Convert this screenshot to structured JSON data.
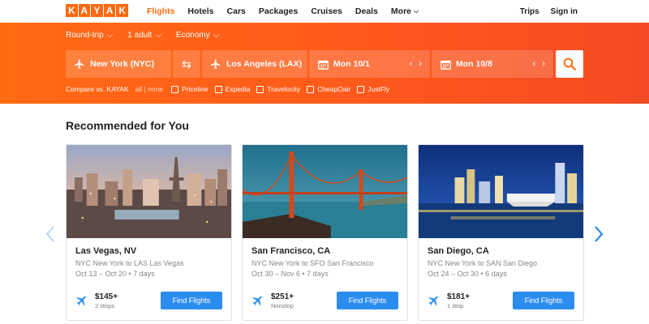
{
  "brand": {
    "logo_letters": [
      "K",
      "A",
      "Y",
      "A",
      "K"
    ],
    "accent": "#ff690f"
  },
  "nav": {
    "items": [
      {
        "label": "Flights",
        "active": true
      },
      {
        "label": "Hotels"
      },
      {
        "label": "Cars"
      },
      {
        "label": "Packages"
      },
      {
        "label": "Cruises"
      },
      {
        "label": "Deals"
      },
      {
        "label": "More"
      }
    ],
    "right": {
      "trips": "Trips",
      "signin": "Sign in"
    }
  },
  "search": {
    "trip_type": "Round-trip",
    "travelers": "1 adult",
    "cabin": "Economy",
    "origin": "New York (NYC)",
    "destination": "Los Angeles (LAX)",
    "depart": "Mon 10/1",
    "return": "Mon 10/8",
    "compare_label": "Compare vs. KAYAK",
    "compare_all": "all",
    "compare_sep": "|",
    "compare_none": "none",
    "providers": [
      "Priceline",
      "Expedia",
      "Travelocity",
      "CheapOair",
      "JustFly"
    ]
  },
  "recommended": {
    "title": "Recommended for You",
    "find_label": "Find Flights",
    "cards": [
      {
        "name": "Las Vegas, NV",
        "route": "NYC New York to LAS Las Vegas",
        "dates": "Oct 13 – Oct 20 • 7 days",
        "price": "$145+",
        "stops": "2 stops"
      },
      {
        "name": "San Francisco, CA",
        "route": "NYC New York to SFO San Francisco",
        "dates": "Oct 30 – Nov 6 • 7 days",
        "price": "$251+",
        "stops": "Nonstop"
      },
      {
        "name": "San Diego, CA",
        "route": "NYC New York to SAN San Diego",
        "dates": "Oct 24 – Oct 30 • 6 days",
        "price": "$181+",
        "stops": "1 stop"
      }
    ]
  },
  "colors": {
    "button_blue": "#2c8df0",
    "arrow_blue": "#2c8df0"
  }
}
